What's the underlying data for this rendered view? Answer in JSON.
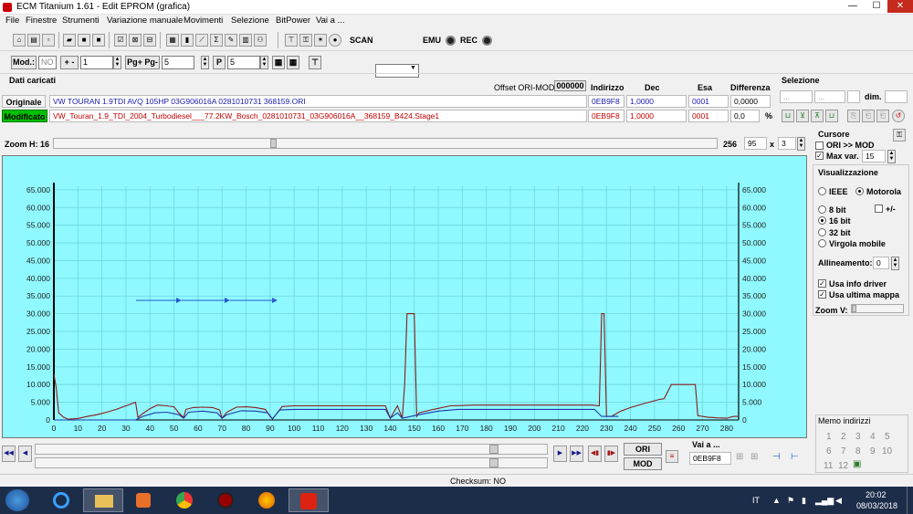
{
  "window": {
    "title": "ECM Titanium 1.61 - Edit EPROM (grafica)",
    "min": "—",
    "max": "☐",
    "close": "✕"
  },
  "menu": [
    "File",
    "Finestre",
    "Strumenti",
    "Variazione manuale",
    "Movimenti",
    "Selezione",
    "BitPower",
    "Vai a ..."
  ],
  "toolbar1": {
    "scan_label": "SCAN",
    "emu_label": "EMU",
    "rec_label": "REC",
    "scan_dropdown_value": ""
  },
  "toolbar2": {
    "mod_label": "Mod.:",
    "mod_value": "NO",
    "plusminus_label": "+ -",
    "step_value": "1",
    "pg_label": "Pg+ Pg-",
    "pg_value": "5",
    "p_value": "5"
  },
  "data_panel": {
    "section_title": "Dati caricati",
    "offset_label": "Offset ORI-MOD",
    "offset_value": "000000",
    "col_indirizzo": "Indirizzo",
    "col_dec": "Dec",
    "col_esa": "Esa",
    "col_differenza": "Differenza",
    "selezione_title": "Selezione",
    "sel_from": "...",
    "sel_to": "...",
    "dim_label": "dim.",
    "original_label": "Originale",
    "modified_label": "Modificato",
    "original_file": "VW TOURAN 1.9TDI AVQ 105HP 03G906016A 0281010731 368159.ORI",
    "modified_file": "VW_Touran_1.9_TDI_2004_Turbodiesel___77.2KW_Bosch_0281010731_03G906016A__368159_B424.Stage1",
    "orig_address": "0EB9F8",
    "orig_dec": "1,0000",
    "orig_esa": "0001",
    "orig_diff": "0,0000",
    "mod_address": "0EB9F8",
    "mod_dec": "1,0000",
    "mod_esa": "0001",
    "mod_diff": "0,0",
    "percent": "%"
  },
  "zoom": {
    "label": "Zoom H: 16",
    "max_value": "256",
    "value": "95",
    "x_label": "x",
    "mult": "3"
  },
  "chart_data": {
    "type": "line",
    "x_ticks": [
      0,
      10,
      20,
      30,
      40,
      50,
      60,
      70,
      80,
      90,
      100,
      110,
      120,
      130,
      140,
      150,
      160,
      170,
      180,
      190,
      200,
      210,
      220,
      230,
      240,
      250,
      260,
      270,
      280
    ],
    "y_ticks": [
      "0",
      "5.000",
      "10.000",
      "15.000",
      "20.000",
      "25.000",
      "30.000",
      "35.000",
      "40.000",
      "45.000",
      "50.000",
      "55.000",
      "60.000",
      "65.000"
    ],
    "xlim": [
      0,
      285
    ],
    "ylim": [
      0,
      66000
    ],
    "series": [
      {
        "color": "#8b1a1a",
        "points": [
          [
            0,
            13000
          ],
          [
            1,
            9000
          ],
          [
            2,
            2000
          ],
          [
            4,
            800
          ],
          [
            6,
            200
          ],
          [
            10,
            400
          ],
          [
            14,
            1000
          ],
          [
            18,
            1500
          ],
          [
            22,
            2200
          ],
          [
            26,
            3000
          ],
          [
            30,
            4000
          ],
          [
            34,
            5000
          ],
          [
            35,
            700
          ],
          [
            37,
            1800
          ],
          [
            40,
            3200
          ],
          [
            43,
            4200
          ],
          [
            47,
            4000
          ],
          [
            50,
            3700
          ],
          [
            52,
            2000
          ],
          [
            54,
            700
          ],
          [
            55,
            3000
          ],
          [
            58,
            3500
          ],
          [
            62,
            3600
          ],
          [
            66,
            3500
          ],
          [
            69,
            2800
          ],
          [
            70,
            500
          ],
          [
            72,
            2200
          ],
          [
            76,
            3600
          ],
          [
            80,
            3700
          ],
          [
            84,
            3500
          ],
          [
            88,
            3000
          ],
          [
            90,
            1000
          ],
          [
            91,
            300
          ],
          [
            93,
            2000
          ],
          [
            95,
            3800
          ],
          [
            100,
            4000
          ],
          [
            110,
            4000
          ],
          [
            120,
            4000
          ],
          [
            130,
            4000
          ],
          [
            138,
            4000
          ],
          [
            140,
            500
          ],
          [
            143,
            4000
          ],
          [
            145,
            500
          ],
          [
            146,
            10000
          ],
          [
            147,
            30000
          ],
          [
            150,
            30000
          ],
          [
            151,
            1000
          ],
          [
            152,
            2000
          ],
          [
            158,
            3000
          ],
          [
            165,
            4000
          ],
          [
            175,
            4200
          ],
          [
            185,
            4200
          ],
          [
            195,
            4200
          ],
          [
            205,
            4200
          ],
          [
            215,
            4200
          ],
          [
            224,
            4200
          ],
          [
            227,
            4000
          ],
          [
            228,
            30000
          ],
          [
            229,
            30000
          ],
          [
            230,
            1000
          ],
          [
            232,
            1000
          ],
          [
            236,
            2500
          ],
          [
            240,
            3500
          ],
          [
            245,
            4500
          ],
          [
            252,
            5800
          ],
          [
            254,
            6000
          ],
          [
            257,
            10000
          ],
          [
            267,
            10000
          ],
          [
            268,
            1200
          ],
          [
            272,
            800
          ],
          [
            276,
            600
          ],
          [
            280,
            500
          ],
          [
            283,
            1000
          ],
          [
            285,
            1000
          ]
        ]
      },
      {
        "color": "#1e3aa8",
        "points": [
          [
            0,
            0
          ],
          [
            34,
            0
          ],
          [
            35,
            300
          ],
          [
            37,
            1000
          ],
          [
            42,
            2000
          ],
          [
            47,
            2200
          ],
          [
            52,
            1500
          ],
          [
            54,
            500
          ],
          [
            56,
            2200
          ],
          [
            62,
            2500
          ],
          [
            68,
            2000
          ],
          [
            70,
            500
          ],
          [
            72,
            1500
          ],
          [
            78,
            2600
          ],
          [
            84,
            2500
          ],
          [
            89,
            2000
          ],
          [
            91,
            300
          ],
          [
            94,
            2800
          ],
          [
            100,
            3000
          ],
          [
            138,
            3000
          ],
          [
            140,
            500
          ],
          [
            143,
            2000
          ],
          [
            145,
            500
          ],
          [
            152,
            1500
          ],
          [
            160,
            2500
          ],
          [
            168,
            3000
          ],
          [
            225,
            3000
          ],
          [
            228,
            1000
          ],
          [
            235,
            1000
          ]
        ]
      }
    ],
    "grid": "on",
    "legend": "none"
  },
  "right_panel": {
    "cursore_title": "Cursore",
    "ori_mod_label": "ORI >> MOD",
    "maxvar_label": "Max var.",
    "maxvar_value": "15",
    "visual_title": "Visualizzazione",
    "ieee_label": "IEEE",
    "motorola_label": "Motorola",
    "bit8_label": "8 bit",
    "plusminus_label": "+/-",
    "bit16_label": "16 bit",
    "bit32_label": "32 bit",
    "float_label": "Virgola mobile",
    "align_label": "Allineamento:",
    "align_value": "0",
    "usa_info_label": "Usa info driver",
    "usa_ultima_label": "Usa ultima mappa",
    "zoomv_label": "Zoom V:",
    "memo_title": "Memo indirizzi",
    "memo_numbers": [
      "1",
      "2",
      "3",
      "4",
      "5",
      "6",
      "7",
      "8",
      "9",
      "10",
      "11",
      "12"
    ]
  },
  "bottom": {
    "ori_label": "ORI",
    "mod_label": "MOD",
    "vai_label": "Vai a ...",
    "vai_value": "0EB9F8"
  },
  "status": {
    "checksum": "Checksum: NO"
  },
  "taskbar": {
    "lang": "IT",
    "time": "20:02",
    "date": "08/03/2018"
  },
  "colors": {
    "plot_bg": "#8ff9ff",
    "modified_badge": "#00c000",
    "close_red": "#c42b1c"
  }
}
